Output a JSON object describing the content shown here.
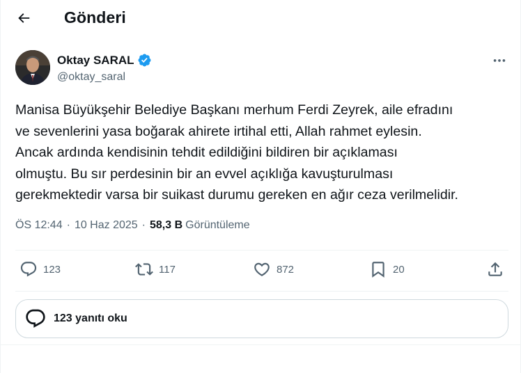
{
  "header": {
    "title": "Gönderi",
    "back_icon": "arrow-left-icon"
  },
  "author": {
    "name": "Oktay SARAL",
    "handle": "@oktay_saral",
    "verified": true,
    "verified_color": "#1d9bf0"
  },
  "tweet": {
    "lines": [
      "Manisa Büyükşehir Belediye Başkanı merhum Ferdi Zeyrek, aile efradını",
      "ve sevenlerini yasa boğarak ahirete irtihal etti, Allah rahmet eylesin.",
      "Ancak ardında kendisinin tehdit edildiğini bildiren bir açıklaması",
      "olmuştu. Bu sır perdesinin bir an evvel açıklığa kavuşturulması",
      "gerekmektedir varsa bir suikast durumu gereken en ağır ceza verilmelidir."
    ],
    "time": "ÖS 12:44",
    "date": "10 Haz 2025",
    "views_count": "58,3 B",
    "views_label": "Görüntüleme"
  },
  "actions": {
    "replies": "123",
    "reposts": "117",
    "likes": "872",
    "bookmarks": "20"
  },
  "reply_prompt": {
    "label": "123 yanıtı oku"
  },
  "colors": {
    "text": "#0f1419",
    "secondary": "#536471",
    "border": "#cfd9de",
    "divider": "#eff3f4"
  }
}
